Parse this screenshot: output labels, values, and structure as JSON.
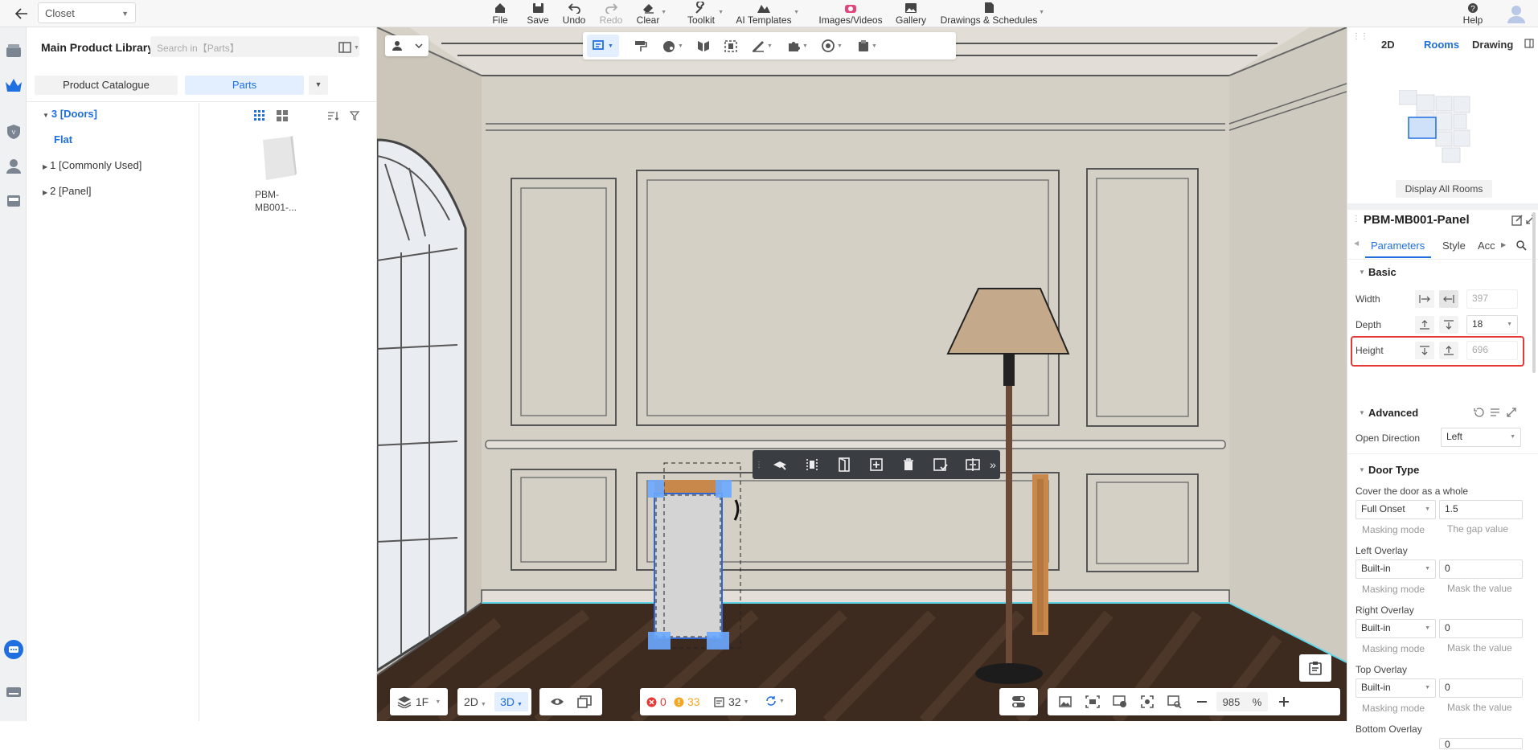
{
  "topbar": {
    "project": "Closet",
    "file": "File",
    "save": "Save",
    "undo": "Undo",
    "redo": "Redo",
    "clear": "Clear",
    "toolkit": "Toolkit",
    "ai_templates": "AI Templates",
    "images_videos": "Images/Videos",
    "gallery": "Gallery",
    "drawings": "Drawings & Schedules",
    "help": "Help"
  },
  "library": {
    "title": "Main Product Library",
    "search_placeholder": "Search in【Parts】",
    "tabs": [
      "Product Catalogue",
      "Parts"
    ],
    "tree": {
      "doors": "3 [Doors]",
      "flat": "Flat",
      "common": "1 [Commonly Used]",
      "panel": "2 [Panel]"
    },
    "product": {
      "name_line1": "PBM-",
      "name_line2": "MB001-..."
    }
  },
  "viewport": {
    "floor": "1F",
    "mode_2d": "2D",
    "mode_3d": "3D",
    "errors": "0",
    "warnings": "33",
    "items": "32",
    "zoom": "985",
    "zoom_unit": "%"
  },
  "right_panel": {
    "view_tabs": [
      "2D",
      "Rooms",
      "Drawing"
    ],
    "display_all_rooms": "Display All Rooms",
    "object_name": "PBM-MB001-Panel",
    "tabs": [
      "Parameters",
      "Style",
      "Acc"
    ],
    "basic": {
      "title": "Basic",
      "width_label": "Width",
      "width_value": "397",
      "depth_label": "Depth",
      "depth_value": "18",
      "height_label": "Height",
      "height_value": "696"
    },
    "advanced": {
      "title": "Advanced",
      "open_direction_label": "Open Direction",
      "open_direction_value": "Left"
    },
    "door_type": {
      "title": "Door Type",
      "cover_label": "Cover the door as a whole",
      "cover_mode": "Full Onset",
      "cover_value": "1.5",
      "cover_mode_sub": "Masking mode",
      "cover_value_sub": "The gap value",
      "left_label": "Left Overlay",
      "left_mode": "Built-in",
      "left_value": "0",
      "right_label": "Right Overlay",
      "right_mode": "Built-in",
      "right_value": "0",
      "top_label": "Top Overlay",
      "top_mode": "Built-in",
      "top_value": "0",
      "bottom_label": "Bottom Overlay",
      "bottom_value": "0",
      "masking_mode": "Masking mode",
      "mask_value": "Mask the value"
    }
  },
  "colors": {
    "accent": "#1f6fe0",
    "highlight": "#e53935",
    "selection": "#6aa8ff"
  }
}
